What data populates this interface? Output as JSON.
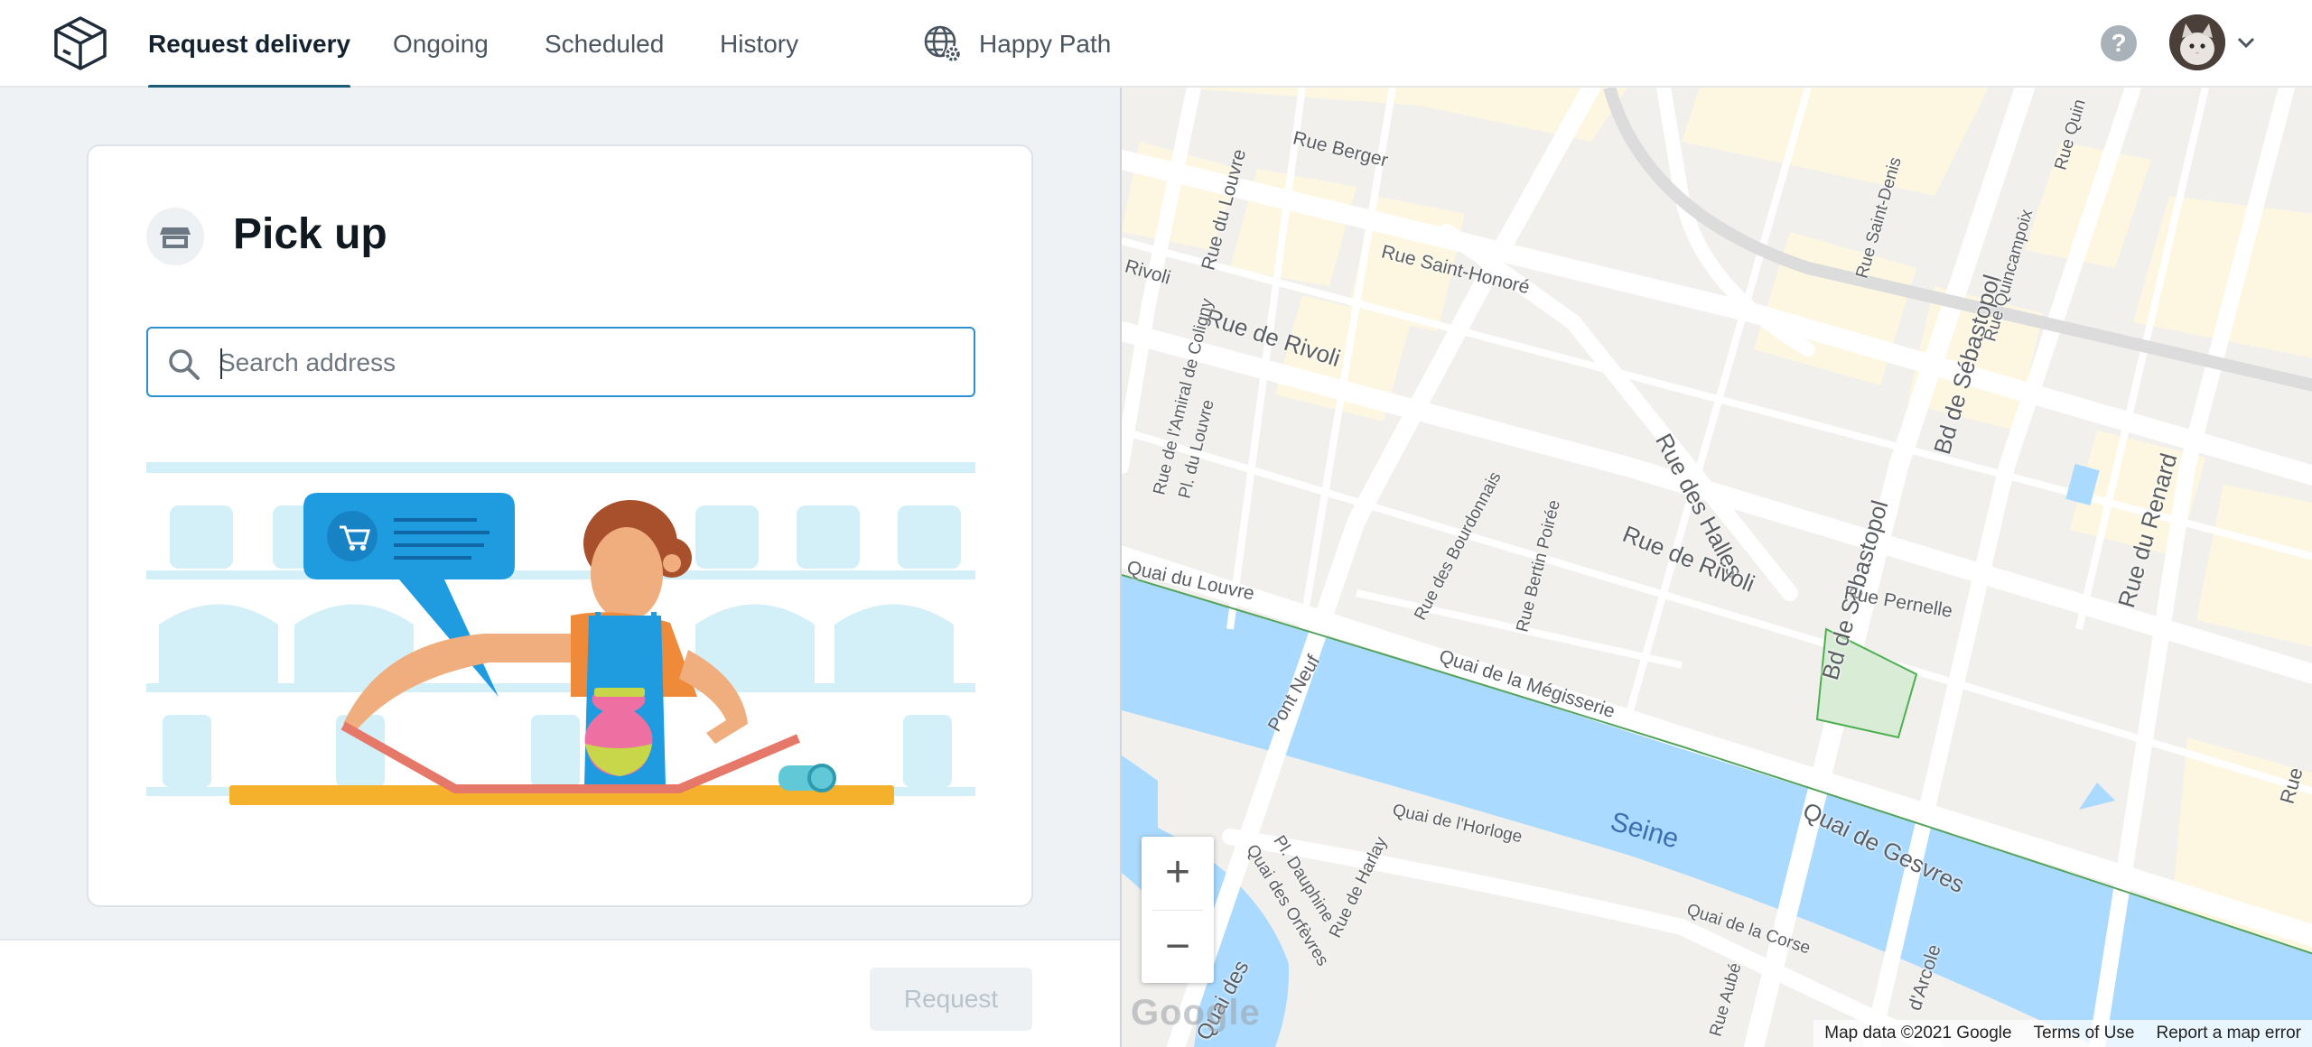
{
  "header": {
    "tabs": [
      {
        "label": "Request delivery",
        "active": true
      },
      {
        "label": "Ongoing",
        "active": false
      },
      {
        "label": "Scheduled",
        "active": false
      },
      {
        "label": "History",
        "active": false
      }
    ],
    "environment_label": "Happy Path",
    "help_label": "?",
    "accent_color": "#1c5a7a"
  },
  "pickup": {
    "title": "Pick up",
    "search_placeholder": "Search address",
    "search_value": ""
  },
  "footer": {
    "request_label": "Request"
  },
  "map": {
    "streets": [
      "Rue Berger",
      "Rue du Louvre",
      "Rue Saint-Honoré",
      "Rivoli",
      "Rue de Rivoli",
      "Rue de l'Amiral de Coligny",
      "Pl. du Louvre",
      "Rue des Halles",
      "Rue de Rivoli",
      "Rue Saint-Denis",
      "Bd de Sébastopol",
      "Bd de Sébastopol",
      "Rue Quincampoix",
      "Rue Quin",
      "Rue du Renard",
      "Rue Pernelle",
      "Quai du Louvre",
      "Rue des Bourdonnais",
      "Rue Bertin Poirée",
      "Quai de la Mégisserie",
      "Pont Neuf",
      "Quai de l'Horloge",
      "Quai des Orfèvres",
      "Pl. Dauphine",
      "Rue de Harlay",
      "Quai de la Corse",
      "Rue Aubé",
      "Quai de Gesvres",
      "Quai des",
      "d'Arcole",
      "Rue"
    ],
    "river_name": "Seine",
    "zoom_in": "+",
    "zoom_out": "−",
    "google_mark": "Google",
    "attribution": [
      "Map data ©2021 Google",
      "Terms of Use",
      "Report a map error"
    ]
  }
}
